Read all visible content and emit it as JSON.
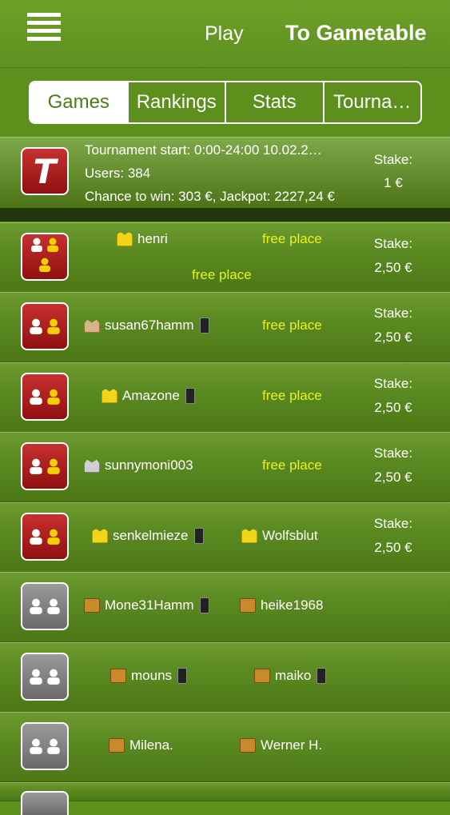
{
  "topbar": {
    "menu_icon": "hamburger-menu-icon",
    "play_label": "Play",
    "gametable_label": "To Gametable"
  },
  "tabs": [
    "Games",
    "Rankings",
    "Stats",
    "Tourna…"
  ],
  "tournament": {
    "badge_letter": "T",
    "line1": "Tournament start: 0:00-24:00  10.02.2…",
    "line2": "Users: 384",
    "line3": "Chance to win: 303 €,  Jackpot: 2227,24 €",
    "stake_label": "Stake:",
    "stake_value": "1 €"
  },
  "rows": [
    {
      "player1": "henri",
      "p1_rank": "gold",
      "p1_phone": false,
      "player2": "free place",
      "p2_free": true,
      "extra": "free place",
      "stake_label": "Stake:",
      "stake": "2,50 €",
      "badge": "red3"
    },
    {
      "player1": "susan67hamm",
      "p1_rank": "cake",
      "p1_phone": true,
      "player2": "free place",
      "p2_free": true,
      "stake_label": "Stake:",
      "stake": "2,50 €",
      "badge": "red2"
    },
    {
      "player1": "Amazone",
      "p1_rank": "gold",
      "p1_phone": true,
      "player2": "free place",
      "p2_free": true,
      "stake_label": "Stake:",
      "stake": "2,50 €",
      "badge": "red2"
    },
    {
      "player1": "sunnymoni003",
      "p1_rank": "grey",
      "p1_phone": false,
      "player2": "free place",
      "p2_free": true,
      "stake_label": "Stake:",
      "stake": "2,50 €",
      "badge": "red2"
    },
    {
      "player1": "senkelmieze",
      "p1_rank": "gold",
      "p1_phone": true,
      "player2": "Wolfsblut",
      "p2_rank": "gold",
      "p2_phone": false,
      "stake_label": "Stake:",
      "stake": "2,50 €",
      "badge": "red2"
    },
    {
      "player1": "Mone31Hamm",
      "p1_rank": "brown",
      "p1_phone": true,
      "player2": "heike1968",
      "p2_rank": "brown",
      "p2_phone": false,
      "badge": "grey2"
    },
    {
      "player1": "mouns",
      "p1_rank": "brown",
      "p1_phone": true,
      "player2": "maiko",
      "p2_rank": "brown",
      "p2_phone": true,
      "badge": "grey2"
    },
    {
      "player1": "Milena.",
      "p1_rank": "brown",
      "p1_phone": false,
      "player2": "Werner H.",
      "p2_rank": "brown",
      "p2_phone": false,
      "badge": "grey2"
    }
  ],
  "colors": {
    "accent": "#5d8f1c",
    "free_place": "#e8f21c",
    "badge_red": "#b52020",
    "badge_grey": "#888888"
  }
}
